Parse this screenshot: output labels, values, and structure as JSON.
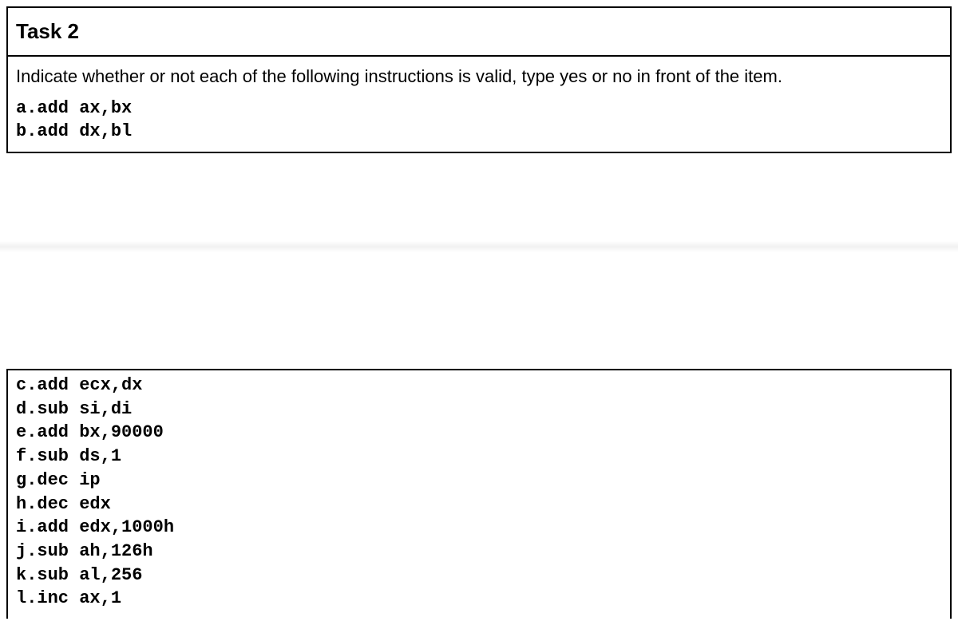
{
  "task": {
    "heading": "Task 2",
    "prompt": "Indicate whether or not each of the following instructions is valid, type yes or no in front of the item.",
    "items_top": [
      "a.add ax,bx",
      "b.add dx,bl"
    ],
    "items_bottom": [
      "c.add ecx,dx",
      "d.sub si,di",
      "e.add bx,90000",
      "f.sub ds,1",
      "g.dec ip",
      "h.dec edx",
      "i.add edx,1000h",
      "j.sub ah,126h",
      "k.sub al,256",
      "l.inc ax,1"
    ]
  }
}
